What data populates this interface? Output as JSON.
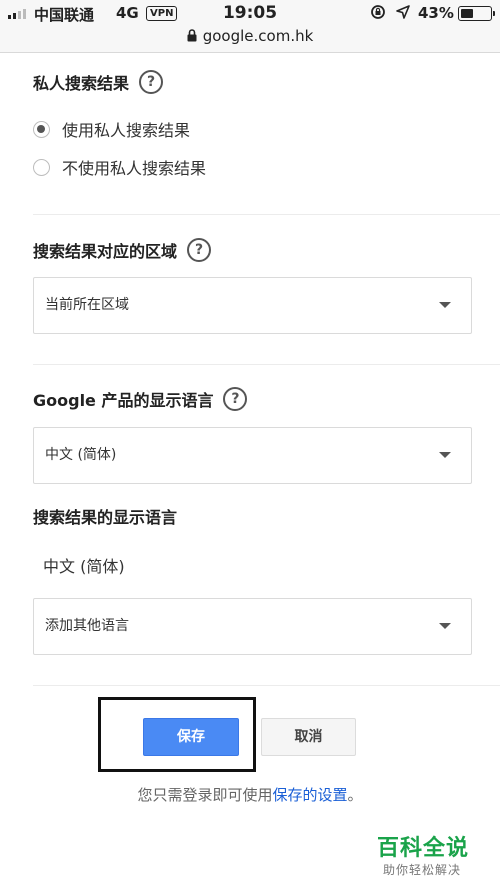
{
  "status_bar": {
    "carrier": "中国联通",
    "network": "4G",
    "vpn": "VPN",
    "time": "19:05",
    "battery_pct": "43%",
    "battery_level": 0.43,
    "url": "google.com.hk"
  },
  "private_results": {
    "title": "私人搜索结果",
    "help": "?",
    "options": [
      "使用私人搜索结果",
      "不使用私人搜索结果"
    ],
    "selected_index": 0
  },
  "region": {
    "title": "搜索结果对应的区域",
    "help": "?",
    "selected": "当前所在区域"
  },
  "product_language": {
    "title": "Google 产品的显示语言",
    "help": "?",
    "selected": "中文 (简体)"
  },
  "results_language": {
    "title": "搜索结果的显示语言",
    "current": "中文 (简体)",
    "add_placeholder": "添加其他语言"
  },
  "actions": {
    "save": "保存",
    "cancel": "取消"
  },
  "signin_note": {
    "prefix": "您只需登录即可使用",
    "link": "保存的设置",
    "suffix": "。"
  },
  "watermark": {
    "main": "百科全说",
    "sub": "助你轻松解决"
  },
  "icons": [
    "signal-icon",
    "lock-icon",
    "rotation-lock-icon",
    "location-arrow-icon",
    "battery-icon",
    "help-icon",
    "chevron-down-icon"
  ]
}
